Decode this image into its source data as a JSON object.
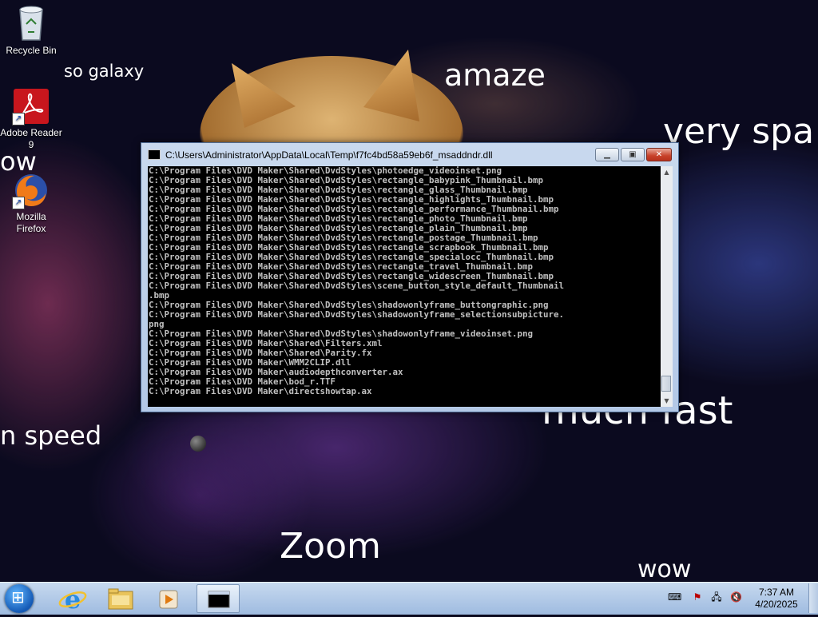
{
  "desktop": {
    "meme_words": [
      "so galaxy",
      "amaze",
      "very spa",
      "ow",
      "n speed",
      "much fast",
      "Zoom",
      "wow"
    ],
    "icons": [
      {
        "label_line1": "Recycle Bin",
        "label_line2": ""
      },
      {
        "label_line1": "Adobe Reader",
        "label_line2": "9"
      },
      {
        "label_line1": "Mozilla",
        "label_line2": "Firefox"
      }
    ]
  },
  "window": {
    "title": "C:\\Users\\Administrator\\AppData\\Local\\Temp\\f7fc4bd58a59eb6f_msaddndr.dll",
    "console_lines": [
      "C:\\Program Files\\DVD Maker\\Shared\\DvdStyles\\photoedge_videoinset.png",
      "C:\\Program Files\\DVD Maker\\Shared\\DvdStyles\\rectangle_babypink_Thumbnail.bmp",
      "C:\\Program Files\\DVD Maker\\Shared\\DvdStyles\\rectangle_glass_Thumbnail.bmp",
      "C:\\Program Files\\DVD Maker\\Shared\\DvdStyles\\rectangle_highlights_Thumbnail.bmp",
      "C:\\Program Files\\DVD Maker\\Shared\\DvdStyles\\rectangle_performance_Thumbnail.bmp",
      "C:\\Program Files\\DVD Maker\\Shared\\DvdStyles\\rectangle_photo_Thumbnail.bmp",
      "C:\\Program Files\\DVD Maker\\Shared\\DvdStyles\\rectangle_plain_Thumbnail.bmp",
      "C:\\Program Files\\DVD Maker\\Shared\\DvdStyles\\rectangle_postage_Thumbnail.bmp",
      "C:\\Program Files\\DVD Maker\\Shared\\DvdStyles\\rectangle_scrapbook_Thumbnail.bmp",
      "C:\\Program Files\\DVD Maker\\Shared\\DvdStyles\\rectangle_specialocc_Thumbnail.bmp",
      "C:\\Program Files\\DVD Maker\\Shared\\DvdStyles\\rectangle_travel_Thumbnail.bmp",
      "C:\\Program Files\\DVD Maker\\Shared\\DvdStyles\\rectangle_widescreen_Thumbnail.bmp",
      "C:\\Program Files\\DVD Maker\\Shared\\DvdStyles\\scene_button_style_default_Thumbnail",
      ".bmp",
      "C:\\Program Files\\DVD Maker\\Shared\\DvdStyles\\shadowonlyframe_buttongraphic.png",
      "C:\\Program Files\\DVD Maker\\Shared\\DvdStyles\\shadowonlyframe_selectionsubpicture.",
      "png",
      "C:\\Program Files\\DVD Maker\\Shared\\DvdStyles\\shadowonlyframe_videoinset.png",
      "C:\\Program Files\\DVD Maker\\Shared\\Filters.xml",
      "C:\\Program Files\\DVD Maker\\Shared\\Parity.fx",
      "C:\\Program Files\\DVD Maker\\WMM2CLIP.dll",
      "C:\\Program Files\\DVD Maker\\audiodepthconverter.ax",
      "C:\\Program Files\\DVD Maker\\bod_r.TTF",
      "C:\\Program Files\\DVD Maker\\directshowtap.ax"
    ]
  },
  "taskbar": {
    "clock_time": "7:37 AM",
    "clock_date": "4/20/2025"
  },
  "colors": {
    "console_bg": "#000000",
    "console_fg": "#c0c0c0",
    "taskbar": "#b3cbe8",
    "close_button": "#c7412a"
  },
  "icons": [
    "recycle-bin-icon",
    "adobe-reader-icon",
    "firefox-icon",
    "start-icon",
    "internet-explorer-icon",
    "file-explorer-icon",
    "media-player-icon",
    "console-icon",
    "action-center-icon",
    "network-icon",
    "speaker-muted-icon",
    "keyboard-icon"
  ]
}
